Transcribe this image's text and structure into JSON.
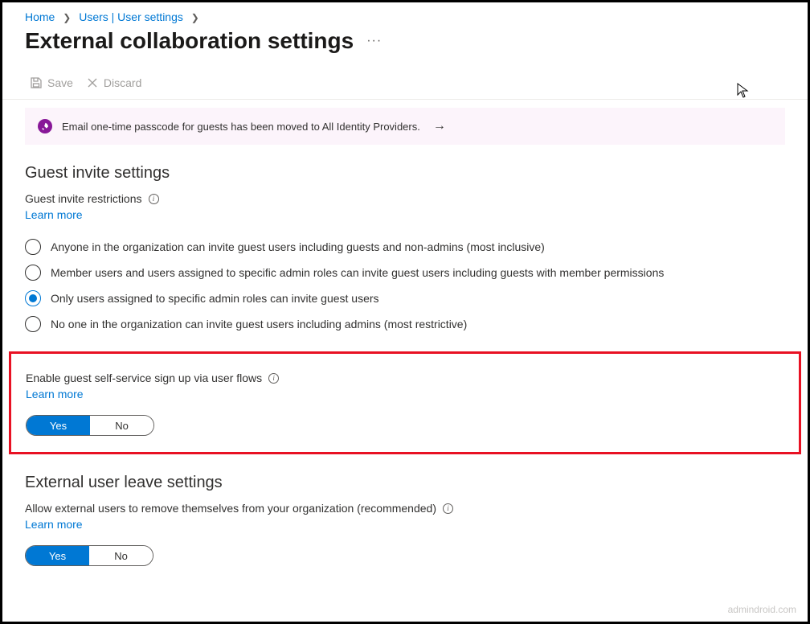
{
  "breadcrumb": {
    "home": "Home",
    "users": "Users | User settings"
  },
  "page": {
    "title": "External collaboration settings",
    "more": "···"
  },
  "toolbar": {
    "save": "Save",
    "discard": "Discard"
  },
  "banner": {
    "text": "Email one-time passcode for guests has been moved to All Identity Providers."
  },
  "guest_invite": {
    "title": "Guest invite settings",
    "restrictions_label": "Guest invite restrictions",
    "learn_more": "Learn more",
    "options": [
      "Anyone in the organization can invite guest users including guests and non-admins (most inclusive)",
      "Member users and users assigned to specific admin roles can invite guest users including guests with member permissions",
      "Only users assigned to specific admin roles can invite guest users",
      "No one in the organization can invite guest users including admins (most restrictive)"
    ],
    "selected_index": 2
  },
  "self_service": {
    "label": "Enable guest self-service sign up via user flows",
    "learn_more": "Learn more",
    "yes": "Yes",
    "no": "No",
    "value": "Yes"
  },
  "external_leave": {
    "title": "External user leave settings",
    "label": "Allow external users to remove themselves from your organization (recommended)",
    "learn_more": "Learn more",
    "yes": "Yes",
    "no": "No",
    "value": "Yes"
  },
  "watermark": "admindroid.com"
}
